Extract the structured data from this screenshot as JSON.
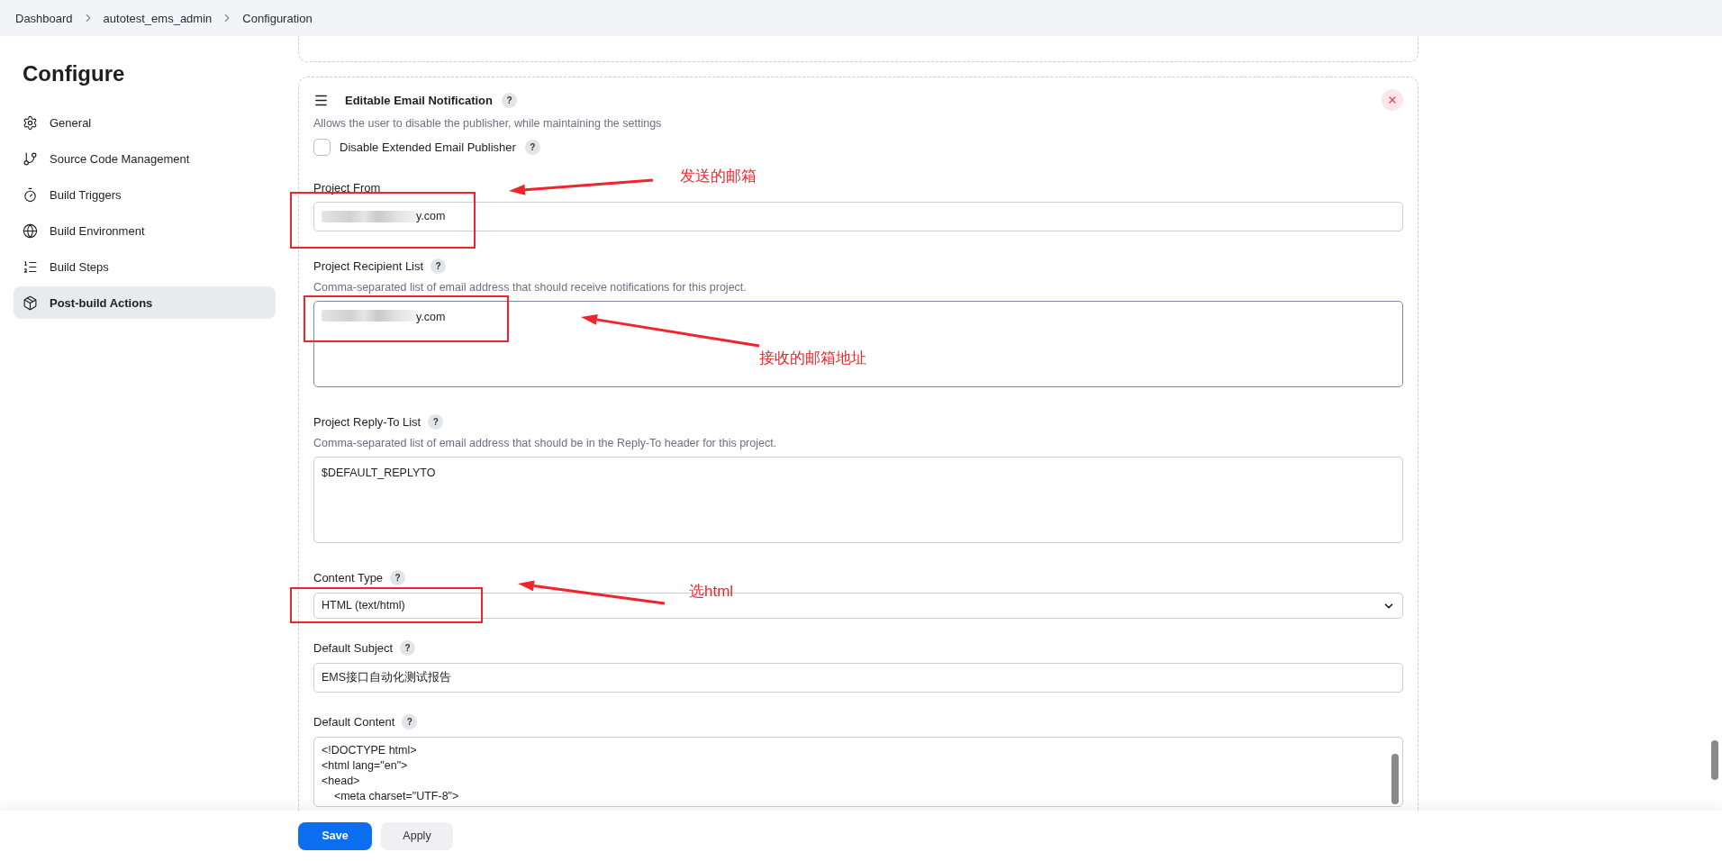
{
  "breadcrumbs": [
    {
      "label": "Dashboard"
    },
    {
      "label": "autotest_ems_admin"
    },
    {
      "label": "Configuration"
    }
  ],
  "sidebar": {
    "title": "Configure",
    "items": [
      {
        "label": "General",
        "selected": false
      },
      {
        "label": "Source Code Management",
        "selected": false
      },
      {
        "label": "Build Triggers",
        "selected": false
      },
      {
        "label": "Build Environment",
        "selected": false
      },
      {
        "label": "Build Steps",
        "selected": false
      },
      {
        "label": "Post-build Actions",
        "selected": true
      }
    ]
  },
  "publisher": {
    "title": "Editable Email Notification",
    "help": "?",
    "description": "Allows the user to disable the publisher, while maintaining the settings",
    "checkbox": {
      "label": "Disable Extended Email Publisher",
      "help": "?",
      "checked": false
    },
    "fields": [
      {
        "kind": "text",
        "label": "Project From",
        "value": "y.com",
        "redacted": true
      },
      {
        "kind": "textarea",
        "label": "Project Recipient List",
        "help": "?",
        "description": "Comma-separated list of email address that should receive notifications for this project.",
        "value": "y.com",
        "redacted": true
      },
      {
        "kind": "textarea",
        "label": "Project Reply-To List",
        "help": "?",
        "description": "Comma-separated list of email address that should be in the Reply-To header for this project.",
        "value": "$DEFAULT_REPLYTO"
      },
      {
        "kind": "select",
        "label": "Content Type",
        "help": "?",
        "value": "HTML (text/html)"
      },
      {
        "kind": "text",
        "label": "Default Subject",
        "help": "?",
        "value": "EMS接口自动化测试报告"
      },
      {
        "kind": "code",
        "label": "Default Content",
        "help": "?",
        "value": "<!DOCTYPE html>\n<html lang=\"en\">\n<head>\n    <meta charset=\"UTF-8\">"
      }
    ]
  },
  "annotations": [
    {
      "text": "发送的邮箱"
    },
    {
      "text": "接收的邮箱地址"
    },
    {
      "text": "选html"
    }
  ],
  "footer": {
    "buttons": [
      {
        "label": "Save",
        "primary": true
      },
      {
        "label": "Apply",
        "primary": false
      }
    ]
  }
}
